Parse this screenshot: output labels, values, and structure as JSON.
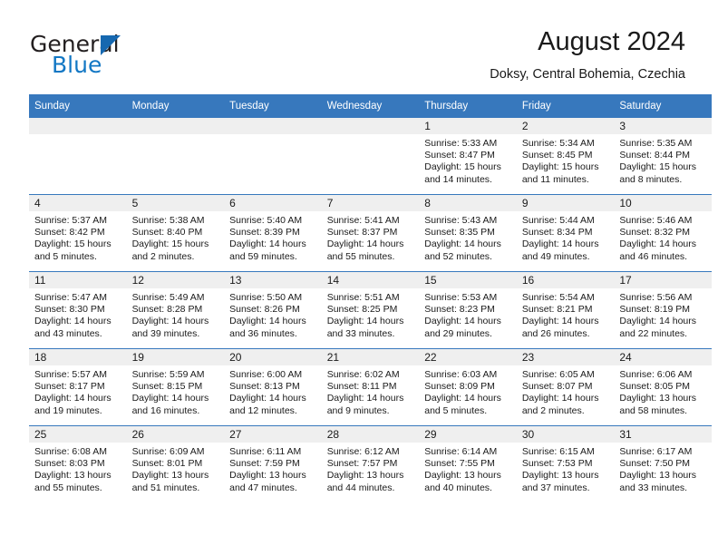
{
  "brand": {
    "name_part1": "General",
    "name_part2": "Blue",
    "triangle_icon": "triangle-icon",
    "accent_color": "#1277c4"
  },
  "header": {
    "title": "August 2024",
    "subtitle": "Doksy, Central Bohemia, Czechia"
  },
  "calendar": {
    "header_color": "#3778bd",
    "daynum_band_color": "#efefef",
    "weekday_headers": [
      "Sunday",
      "Monday",
      "Tuesday",
      "Wednesday",
      "Thursday",
      "Friday",
      "Saturday"
    ],
    "weeks": [
      [
        {
          "day": "",
          "empty": true
        },
        {
          "day": "",
          "empty": true
        },
        {
          "day": "",
          "empty": true
        },
        {
          "day": "",
          "empty": true
        },
        {
          "day": "1",
          "sunrise": "Sunrise: 5:33 AM",
          "sunset": "Sunset: 8:47 PM",
          "daylight1": "Daylight: 15 hours",
          "daylight2": "and 14 minutes."
        },
        {
          "day": "2",
          "sunrise": "Sunrise: 5:34 AM",
          "sunset": "Sunset: 8:45 PM",
          "daylight1": "Daylight: 15 hours",
          "daylight2": "and 11 minutes."
        },
        {
          "day": "3",
          "sunrise": "Sunrise: 5:35 AM",
          "sunset": "Sunset: 8:44 PM",
          "daylight1": "Daylight: 15 hours",
          "daylight2": "and 8 minutes."
        }
      ],
      [
        {
          "day": "4",
          "sunrise": "Sunrise: 5:37 AM",
          "sunset": "Sunset: 8:42 PM",
          "daylight1": "Daylight: 15 hours",
          "daylight2": "and 5 minutes."
        },
        {
          "day": "5",
          "sunrise": "Sunrise: 5:38 AM",
          "sunset": "Sunset: 8:40 PM",
          "daylight1": "Daylight: 15 hours",
          "daylight2": "and 2 minutes."
        },
        {
          "day": "6",
          "sunrise": "Sunrise: 5:40 AM",
          "sunset": "Sunset: 8:39 PM",
          "daylight1": "Daylight: 14 hours",
          "daylight2": "and 59 minutes."
        },
        {
          "day": "7",
          "sunrise": "Sunrise: 5:41 AM",
          "sunset": "Sunset: 8:37 PM",
          "daylight1": "Daylight: 14 hours",
          "daylight2": "and 55 minutes."
        },
        {
          "day": "8",
          "sunrise": "Sunrise: 5:43 AM",
          "sunset": "Sunset: 8:35 PM",
          "daylight1": "Daylight: 14 hours",
          "daylight2": "and 52 minutes."
        },
        {
          "day": "9",
          "sunrise": "Sunrise: 5:44 AM",
          "sunset": "Sunset: 8:34 PM",
          "daylight1": "Daylight: 14 hours",
          "daylight2": "and 49 minutes."
        },
        {
          "day": "10",
          "sunrise": "Sunrise: 5:46 AM",
          "sunset": "Sunset: 8:32 PM",
          "daylight1": "Daylight: 14 hours",
          "daylight2": "and 46 minutes."
        }
      ],
      [
        {
          "day": "11",
          "sunrise": "Sunrise: 5:47 AM",
          "sunset": "Sunset: 8:30 PM",
          "daylight1": "Daylight: 14 hours",
          "daylight2": "and 43 minutes."
        },
        {
          "day": "12",
          "sunrise": "Sunrise: 5:49 AM",
          "sunset": "Sunset: 8:28 PM",
          "daylight1": "Daylight: 14 hours",
          "daylight2": "and 39 minutes."
        },
        {
          "day": "13",
          "sunrise": "Sunrise: 5:50 AM",
          "sunset": "Sunset: 8:26 PM",
          "daylight1": "Daylight: 14 hours",
          "daylight2": "and 36 minutes."
        },
        {
          "day": "14",
          "sunrise": "Sunrise: 5:51 AM",
          "sunset": "Sunset: 8:25 PM",
          "daylight1": "Daylight: 14 hours",
          "daylight2": "and 33 minutes."
        },
        {
          "day": "15",
          "sunrise": "Sunrise: 5:53 AM",
          "sunset": "Sunset: 8:23 PM",
          "daylight1": "Daylight: 14 hours",
          "daylight2": "and 29 minutes."
        },
        {
          "day": "16",
          "sunrise": "Sunrise: 5:54 AM",
          "sunset": "Sunset: 8:21 PM",
          "daylight1": "Daylight: 14 hours",
          "daylight2": "and 26 minutes."
        },
        {
          "day": "17",
          "sunrise": "Sunrise: 5:56 AM",
          "sunset": "Sunset: 8:19 PM",
          "daylight1": "Daylight: 14 hours",
          "daylight2": "and 22 minutes."
        }
      ],
      [
        {
          "day": "18",
          "sunrise": "Sunrise: 5:57 AM",
          "sunset": "Sunset: 8:17 PM",
          "daylight1": "Daylight: 14 hours",
          "daylight2": "and 19 minutes."
        },
        {
          "day": "19",
          "sunrise": "Sunrise: 5:59 AM",
          "sunset": "Sunset: 8:15 PM",
          "daylight1": "Daylight: 14 hours",
          "daylight2": "and 16 minutes."
        },
        {
          "day": "20",
          "sunrise": "Sunrise: 6:00 AM",
          "sunset": "Sunset: 8:13 PM",
          "daylight1": "Daylight: 14 hours",
          "daylight2": "and 12 minutes."
        },
        {
          "day": "21",
          "sunrise": "Sunrise: 6:02 AM",
          "sunset": "Sunset: 8:11 PM",
          "daylight1": "Daylight: 14 hours",
          "daylight2": "and 9 minutes."
        },
        {
          "day": "22",
          "sunrise": "Sunrise: 6:03 AM",
          "sunset": "Sunset: 8:09 PM",
          "daylight1": "Daylight: 14 hours",
          "daylight2": "and 5 minutes."
        },
        {
          "day": "23",
          "sunrise": "Sunrise: 6:05 AM",
          "sunset": "Sunset: 8:07 PM",
          "daylight1": "Daylight: 14 hours",
          "daylight2": "and 2 minutes."
        },
        {
          "day": "24",
          "sunrise": "Sunrise: 6:06 AM",
          "sunset": "Sunset: 8:05 PM",
          "daylight1": "Daylight: 13 hours",
          "daylight2": "and 58 minutes."
        }
      ],
      [
        {
          "day": "25",
          "sunrise": "Sunrise: 6:08 AM",
          "sunset": "Sunset: 8:03 PM",
          "daylight1": "Daylight: 13 hours",
          "daylight2": "and 55 minutes."
        },
        {
          "day": "26",
          "sunrise": "Sunrise: 6:09 AM",
          "sunset": "Sunset: 8:01 PM",
          "daylight1": "Daylight: 13 hours",
          "daylight2": "and 51 minutes."
        },
        {
          "day": "27",
          "sunrise": "Sunrise: 6:11 AM",
          "sunset": "Sunset: 7:59 PM",
          "daylight1": "Daylight: 13 hours",
          "daylight2": "and 47 minutes."
        },
        {
          "day": "28",
          "sunrise": "Sunrise: 6:12 AM",
          "sunset": "Sunset: 7:57 PM",
          "daylight1": "Daylight: 13 hours",
          "daylight2": "and 44 minutes."
        },
        {
          "day": "29",
          "sunrise": "Sunrise: 6:14 AM",
          "sunset": "Sunset: 7:55 PM",
          "daylight1": "Daylight: 13 hours",
          "daylight2": "and 40 minutes."
        },
        {
          "day": "30",
          "sunrise": "Sunrise: 6:15 AM",
          "sunset": "Sunset: 7:53 PM",
          "daylight1": "Daylight: 13 hours",
          "daylight2": "and 37 minutes."
        },
        {
          "day": "31",
          "sunrise": "Sunrise: 6:17 AM",
          "sunset": "Sunset: 7:50 PM",
          "daylight1": "Daylight: 13 hours",
          "daylight2": "and 33 minutes."
        }
      ]
    ]
  }
}
